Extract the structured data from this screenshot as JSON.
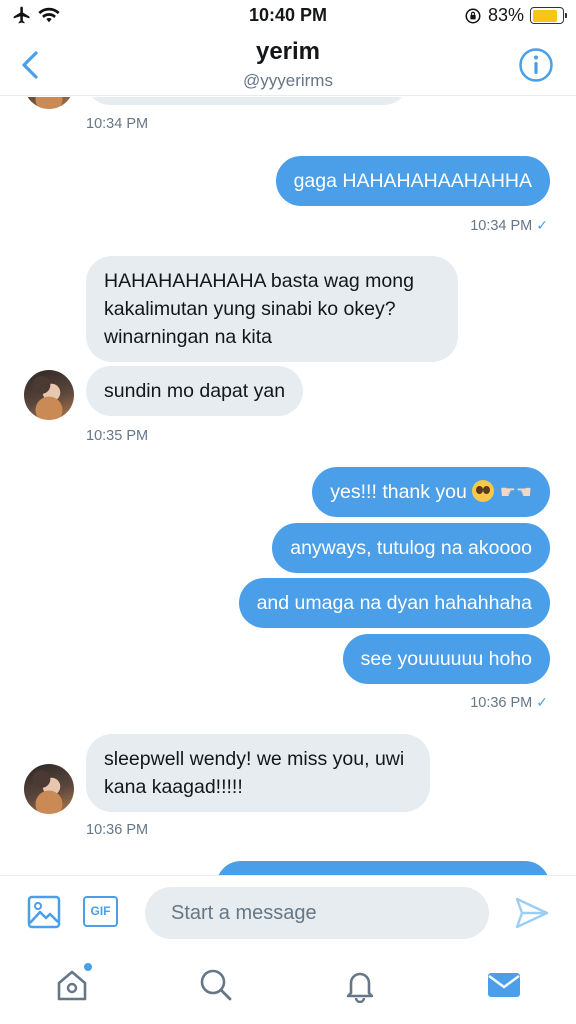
{
  "status_bar": {
    "time": "10:40 PM",
    "battery_text": "83%",
    "battery_level": 0.83,
    "icons": [
      "airplane-icon",
      "wifi-icon",
      "orientation-lock-icon",
      "battery-icon"
    ]
  },
  "header": {
    "name": "yerim",
    "handle": "@yyyerirms",
    "back_icon": "chevron-left-icon",
    "info_icon": "info-icon"
  },
  "conversation": {
    "timestamps": {
      "t0": "10:34 PM",
      "t1": "10:34 PM",
      "t2": "10:35 PM",
      "t3": "10:36 PM",
      "t4": "10:36 PM"
    },
    "messages": {
      "out1": "gaga HAHAHAHAAHAHHA",
      "in1": "HAHAHAHAHAHA basta wag mong kakalimutan yung sinabi ko okey? winarningan na kita",
      "in2": "sundin mo dapat yan",
      "out2": "yes!!! thank you",
      "out3": "anyways, tutulog na akoooo",
      "out4": "and umaga na dyan hahahhaha",
      "out5": "see youuuuuu hoho",
      "in3": "sleepwell wendy! we miss you, uwi kana kaagad!!!!!"
    },
    "read_check": "✓",
    "accent_color": "#4a9fe8"
  },
  "composer": {
    "placeholder": "Start a message",
    "gif_label": "GIF"
  },
  "tabbar": {
    "tabs": [
      "home-icon",
      "search-icon",
      "notifications-icon",
      "messages-icon"
    ],
    "active": "messages-icon"
  }
}
